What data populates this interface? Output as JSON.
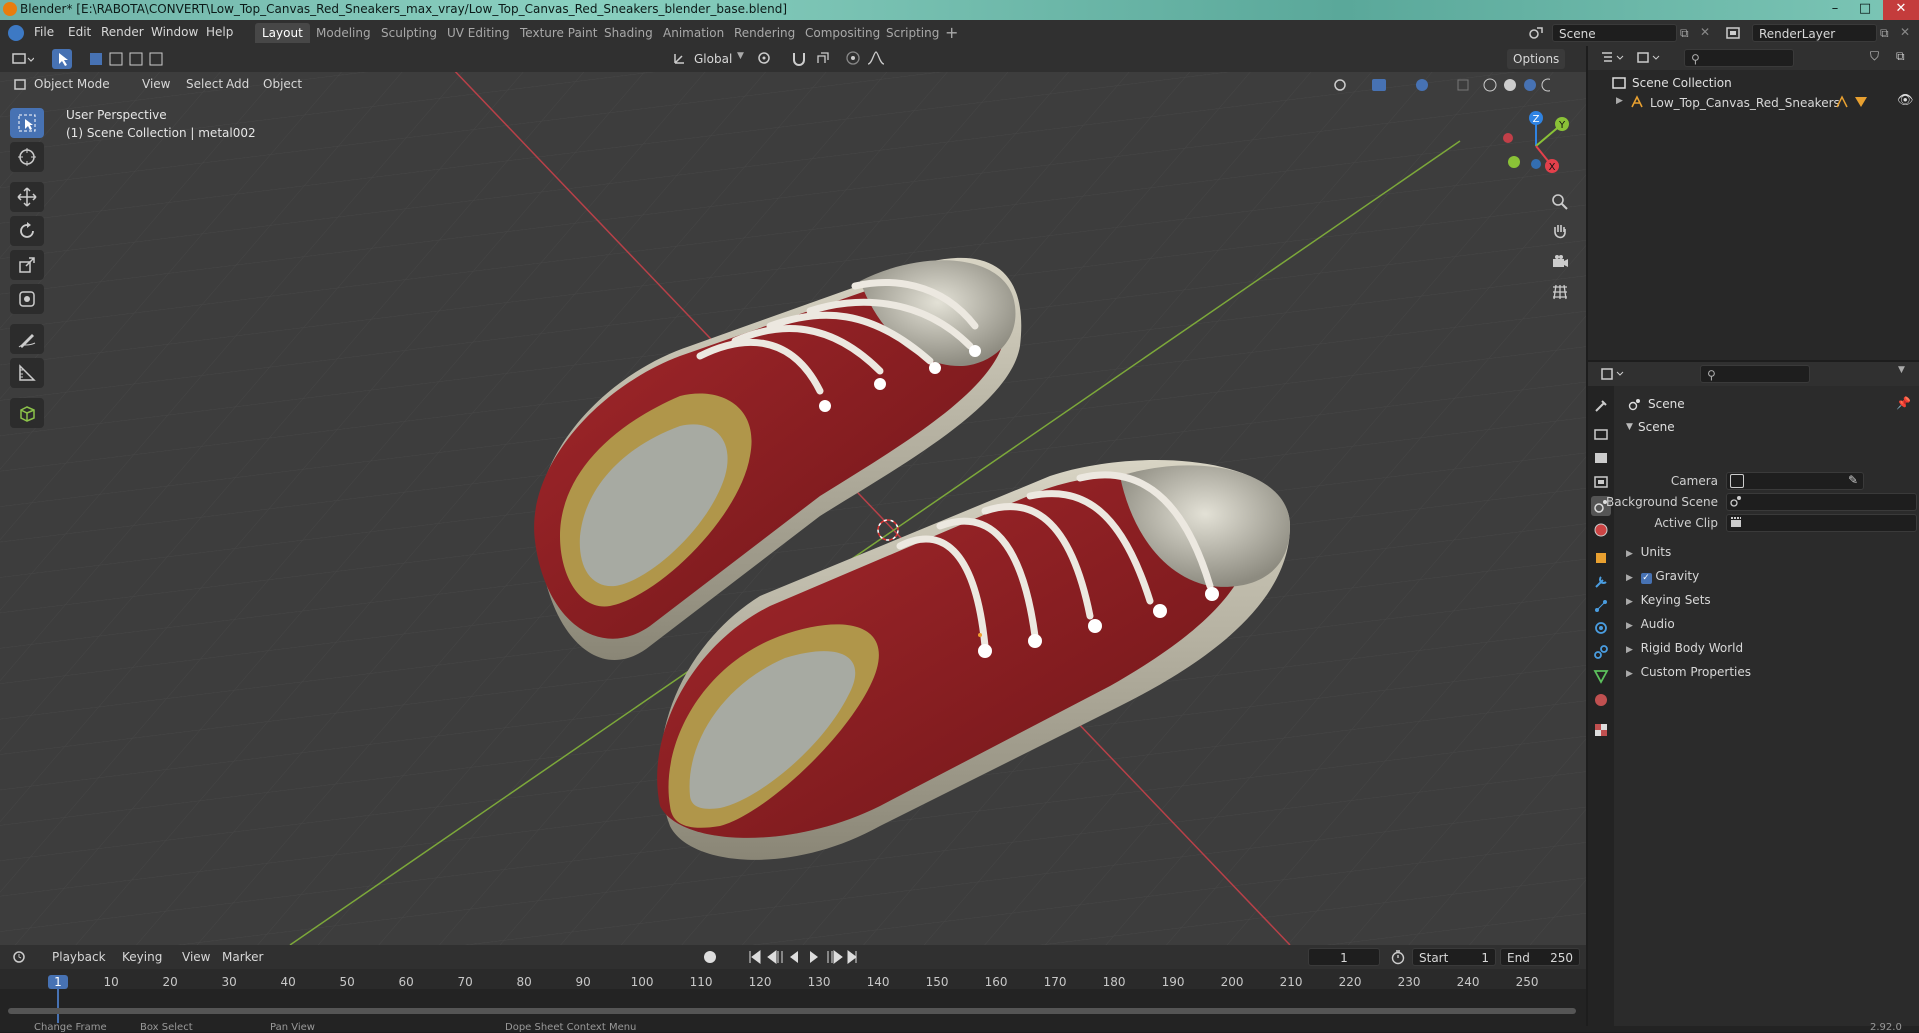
{
  "window": {
    "title": "Blender* [E:\\RABOTA\\CONVERT\\Low_Top_Canvas_Red_Sneakers_max_vray/Low_Top_Canvas_Red_Sneakers_blender_base.blend]"
  },
  "menu": [
    "File",
    "Edit",
    "Render",
    "Window",
    "Help"
  ],
  "workspaces": [
    "Layout",
    "Modeling",
    "Sculpting",
    "UV Editing",
    "Texture Paint",
    "Shading",
    "Animation",
    "Rendering",
    "Compositing",
    "Scripting"
  ],
  "scene_field": "Scene",
  "renderlayer_field": "RenderLayer",
  "viewport": {
    "transform_orientation": "Global",
    "options_label": "Options",
    "mode": "Object Mode",
    "header_menus": [
      "View",
      "Select",
      "Add",
      "Object"
    ],
    "perspective_label": "User Perspective",
    "context_label": "(1) Scene Collection | metal002",
    "gizmo_axes": [
      "Z",
      "Y",
      "X"
    ]
  },
  "outliner": {
    "root": "Scene Collection",
    "items": [
      "Low_Top_Canvas_Red_Sneakers"
    ]
  },
  "properties": {
    "header": "Scene",
    "panel_title": "Scene",
    "fields": [
      {
        "label": "Camera",
        "value": ""
      },
      {
        "label": "Background Scene",
        "value": ""
      },
      {
        "label": "Active Clip",
        "value": ""
      }
    ],
    "sections": [
      {
        "label": "Units",
        "checkbox": false
      },
      {
        "label": "Gravity",
        "checkbox": true
      },
      {
        "label": "Keying Sets",
        "checkbox": false
      },
      {
        "label": "Audio",
        "checkbox": false
      },
      {
        "label": "Rigid Body World",
        "checkbox": false
      },
      {
        "label": "Custom Properties",
        "checkbox": false
      }
    ]
  },
  "timeline": {
    "menus": [
      "Playback",
      "Keying",
      "View",
      "Marker"
    ],
    "current_frame": "1",
    "start_label": "Start",
    "start": "1",
    "end_label": "End",
    "end": "250",
    "ticks": [
      "1",
      "10",
      "20",
      "30",
      "40",
      "50",
      "60",
      "70",
      "80",
      "90",
      "100",
      "110",
      "120",
      "130",
      "140",
      "150",
      "160",
      "170",
      "180",
      "190",
      "200",
      "210",
      "220",
      "230",
      "240",
      "250"
    ]
  },
  "statusbar": {
    "items": [
      "Change Frame",
      "Box Select",
      "Pan View",
      "Dope Sheet Context Menu"
    ],
    "version": "2.92.0"
  },
  "colors": {
    "accent": "#4772b3",
    "x_axis": "#e3404b",
    "y_axis": "#8ac237",
    "z_axis": "#2f83e2",
    "shoe_red": "#8e1e22"
  }
}
